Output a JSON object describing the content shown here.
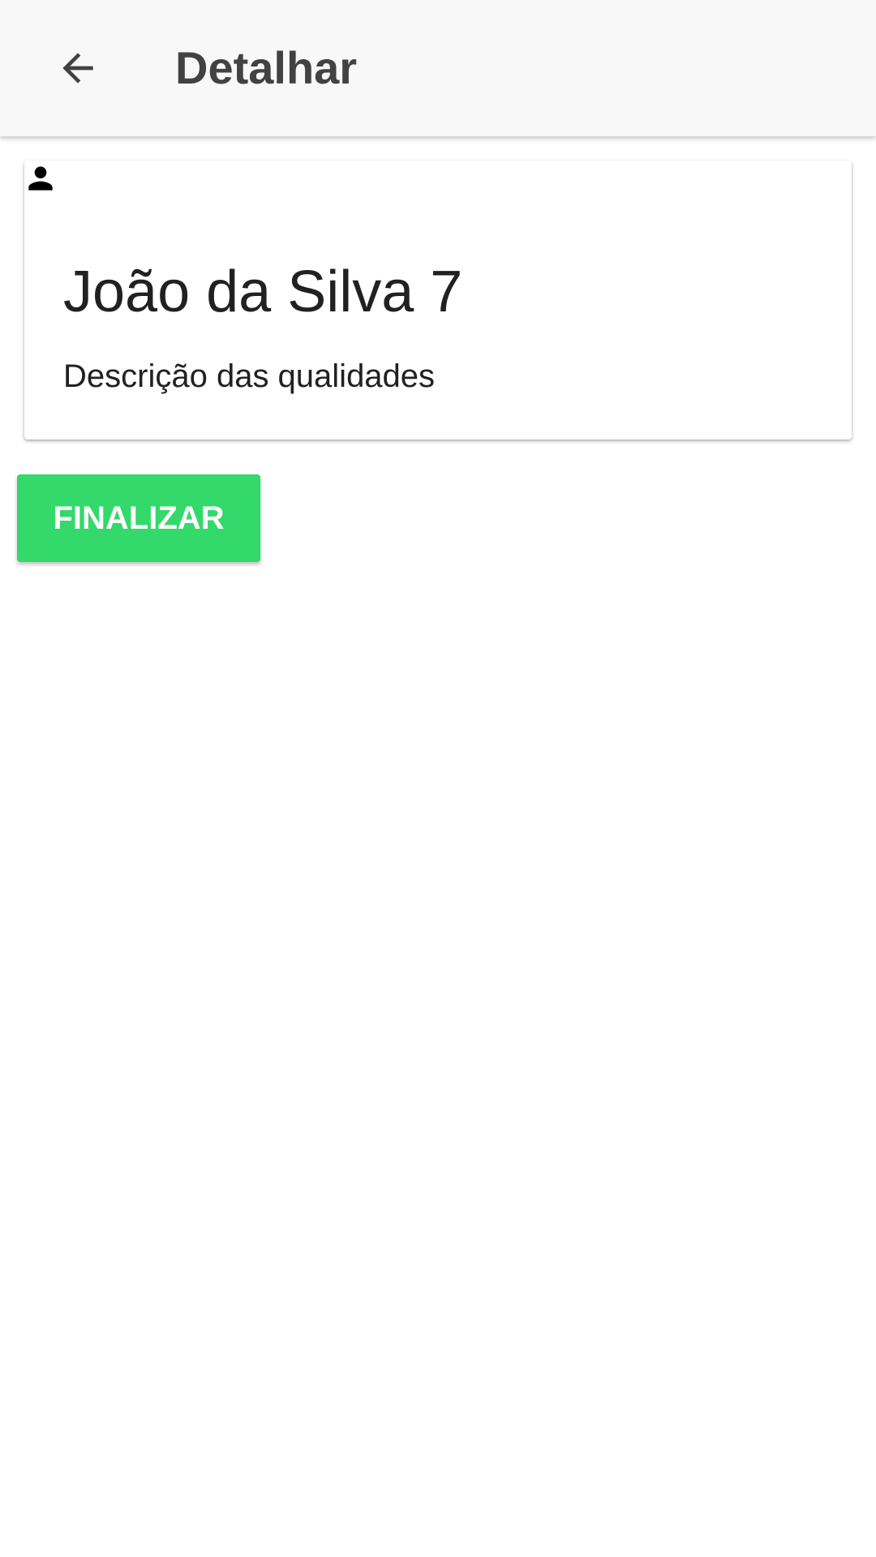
{
  "header": {
    "title": "Detalhar",
    "back_icon": "arrow-back-icon"
  },
  "card": {
    "avatar_icon": "person-icon",
    "name": "João da Silva 7",
    "description": "Descrição das qualidades"
  },
  "actions": {
    "finalize_label": "FINALIZAR"
  },
  "colors": {
    "app_bar_background": "#f8f8f8",
    "title_text": "#424242",
    "body_text": "#212121",
    "button_background": "#33d96a",
    "button_text": "#ffffff"
  }
}
